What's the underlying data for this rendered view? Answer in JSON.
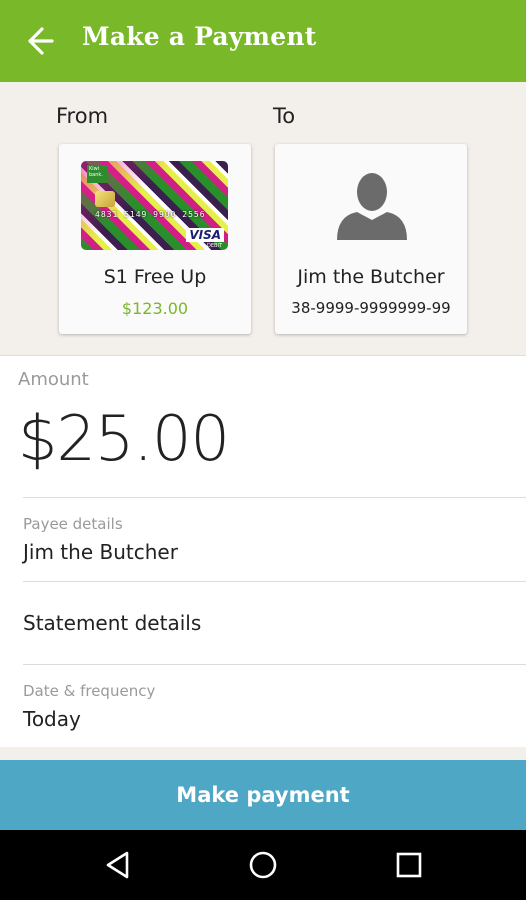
{
  "appbar": {
    "title": "Make a Payment",
    "back_icon": "arrow-left-icon"
  },
  "transfer": {
    "from_label": "From",
    "to_label": "To",
    "from_account": {
      "name": "S1 Free Up",
      "balance": "$123.00",
      "card_logo": "Kiwi bank.",
      "card_number": "4831 5149 9900 2556",
      "card_brand": "VISA",
      "card_type": "DEBIT"
    },
    "to_payee": {
      "name": "Jim the Butcher",
      "account": "38-9999-9999999-99",
      "avatar_icon": "person-icon"
    }
  },
  "amount": {
    "label": "Amount",
    "value": "$25.00"
  },
  "fields": [
    {
      "label": "Payee details",
      "value": "Jim the Butcher"
    },
    {
      "label": "",
      "value": "Statement details"
    },
    {
      "label": "Date & frequency",
      "value": "Today"
    }
  ],
  "action": {
    "label": "Make payment"
  },
  "colors": {
    "accent": "#78b829",
    "button": "#4ea7c4",
    "balance": "#78b829"
  },
  "system_nav": {
    "icons": [
      "back-triangle-icon",
      "home-circle-icon",
      "recents-square-icon"
    ]
  }
}
